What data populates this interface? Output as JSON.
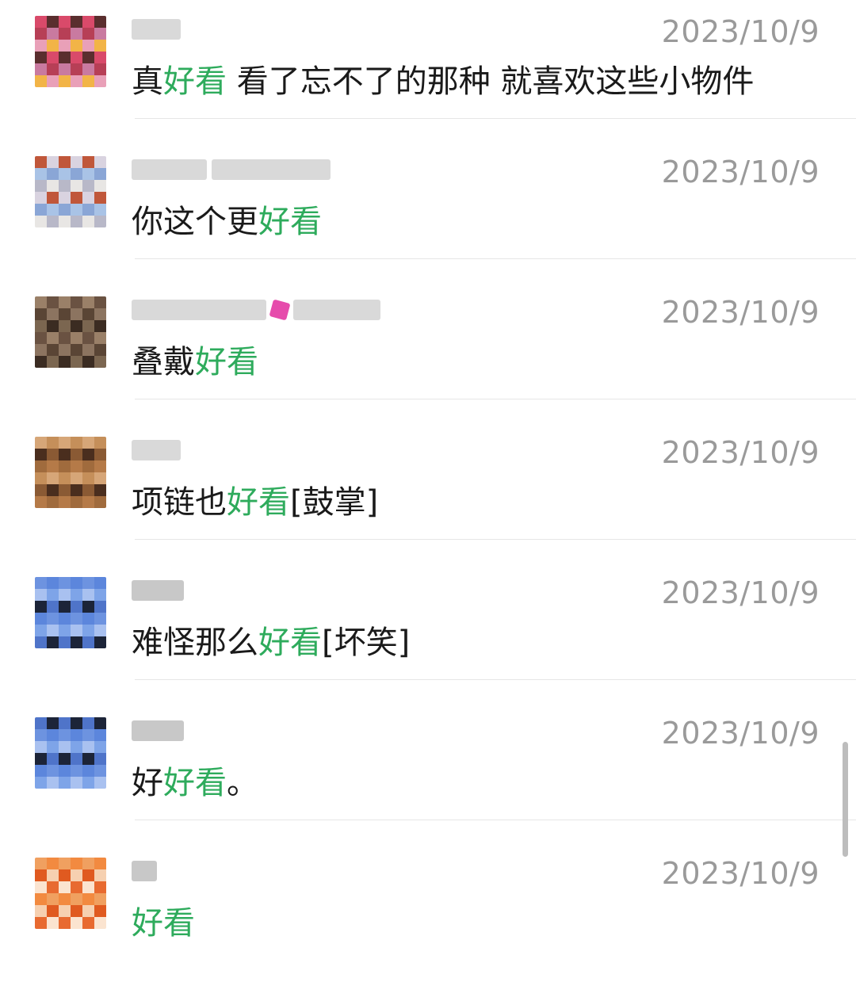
{
  "comments": [
    {
      "date": "2023/10/9",
      "text_parts": [
        {
          "t": "真",
          "hl": false
        },
        {
          "t": "好看",
          "hl": true
        },
        {
          "t": " 看了忘不了的那种 就喜欢这些小物件",
          "hl": false
        }
      ],
      "avatar_colors": [
        "#d94a6a",
        "#f2b447",
        "#c97aa0",
        "#5a2e2e",
        "#e9a0b8",
        "#b73f56"
      ]
    },
    {
      "date": "2023/10/9",
      "text_parts": [
        {
          "t": "你这个更",
          "hl": false
        },
        {
          "t": "好看",
          "hl": true
        }
      ],
      "avatar_colors": [
        "#a9c3e6",
        "#c0573a",
        "#e8e6e4",
        "#8aa6d6",
        "#d9d3e0",
        "#b8b8c8"
      ]
    },
    {
      "date": "2023/10/9",
      "text_parts": [
        {
          "t": "叠戴",
          "hl": false
        },
        {
          "t": "好看",
          "hl": true
        }
      ],
      "avatar_colors": [
        "#7b6650",
        "#5a4535",
        "#9a8068",
        "#3b2c22",
        "#8c7460",
        "#6a5242"
      ]
    },
    {
      "date": "2023/10/9",
      "text_parts": [
        {
          "t": "项链也",
          "hl": false
        },
        {
          "t": "好看",
          "hl": true
        },
        {
          "t": "[鼓掌]",
          "hl": false
        }
      ],
      "avatar_colors": [
        "#c58f5a",
        "#a06b3d",
        "#4a2e1e",
        "#d6a678",
        "#b57a48",
        "#8a5a34"
      ]
    },
    {
      "date": "2023/10/9",
      "text_parts": [
        {
          "t": "难怪那么",
          "hl": false
        },
        {
          "t": "好看",
          "hl": true
        },
        {
          "t": "[坏笑]",
          "hl": false
        }
      ],
      "avatar_colors": [
        "#7ea4e8",
        "#5c86dc",
        "#1c2438",
        "#a9c1f0",
        "#6d93e0",
        "#4f74c9"
      ]
    },
    {
      "date": "2023/10/9",
      "text_parts": [
        {
          "t": "好",
          "hl": false
        },
        {
          "t": "好看",
          "hl": true
        },
        {
          "t": "。",
          "hl": false
        }
      ],
      "avatar_colors": [
        "#7ea4e8",
        "#5c86dc",
        "#1c2438",
        "#a9c1f0",
        "#6d93e0",
        "#4f74c9"
      ]
    },
    {
      "date": "2023/10/9",
      "text_parts": [
        {
          "t": "好看",
          "hl": true
        }
      ],
      "avatar_colors": [
        "#f0a060",
        "#e86a30",
        "#f6d0b0",
        "#f28a40",
        "#fbe4d0",
        "#e05a20"
      ]
    }
  ],
  "highlight_color": "#2eab5c",
  "date_color": "#9a9a9a",
  "icons": {
    "avatar": "user-avatar-icon"
  }
}
